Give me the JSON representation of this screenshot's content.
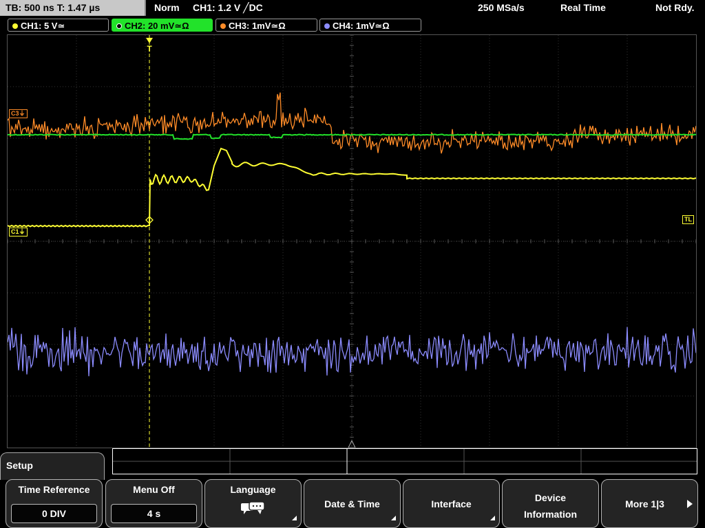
{
  "status": {
    "timebase": "TB: 500 ns   T: 1.47 µs",
    "trigger_mode": "Norm",
    "trigger_info": "CH1: 1.2 V ╱DC",
    "sample_rate": "250 MSa/s",
    "acq_mode": "Real Time",
    "state": "Not Rdy."
  },
  "channels": [
    {
      "label": "CH1: 5 V≃",
      "color": "#ffff33"
    },
    {
      "label": "CH2: 20 mV≃Ω",
      "color": "#22e22a"
    },
    {
      "label": "CH3: 1mV≃Ω",
      "color": "#ff8c28"
    },
    {
      "label": "CH4: 1mV≃Ω",
      "color": "#8c8cff"
    }
  ],
  "markers": {
    "c3": "C3⏚",
    "c1": "C1⏚",
    "tl": "TL",
    "trigger": "T"
  },
  "menu": {
    "title": "Setup",
    "keys": [
      {
        "label": "Time Reference",
        "value": "0 DIV"
      },
      {
        "label": "Menu Off",
        "value": "4 s"
      },
      {
        "label": "Language",
        "icon": "speech-bubble-icon"
      },
      {
        "label": "Date & Time"
      },
      {
        "label": "Interface"
      },
      {
        "label1": "Device",
        "label2": "Information"
      },
      {
        "label": "More 1|3"
      }
    ]
  },
  "colors": {
    "ch1": "#ffff33",
    "ch2": "#22e22a",
    "ch3": "#ff8c28",
    "ch4": "#8c8cff",
    "grid": "#3c3c3c"
  }
}
